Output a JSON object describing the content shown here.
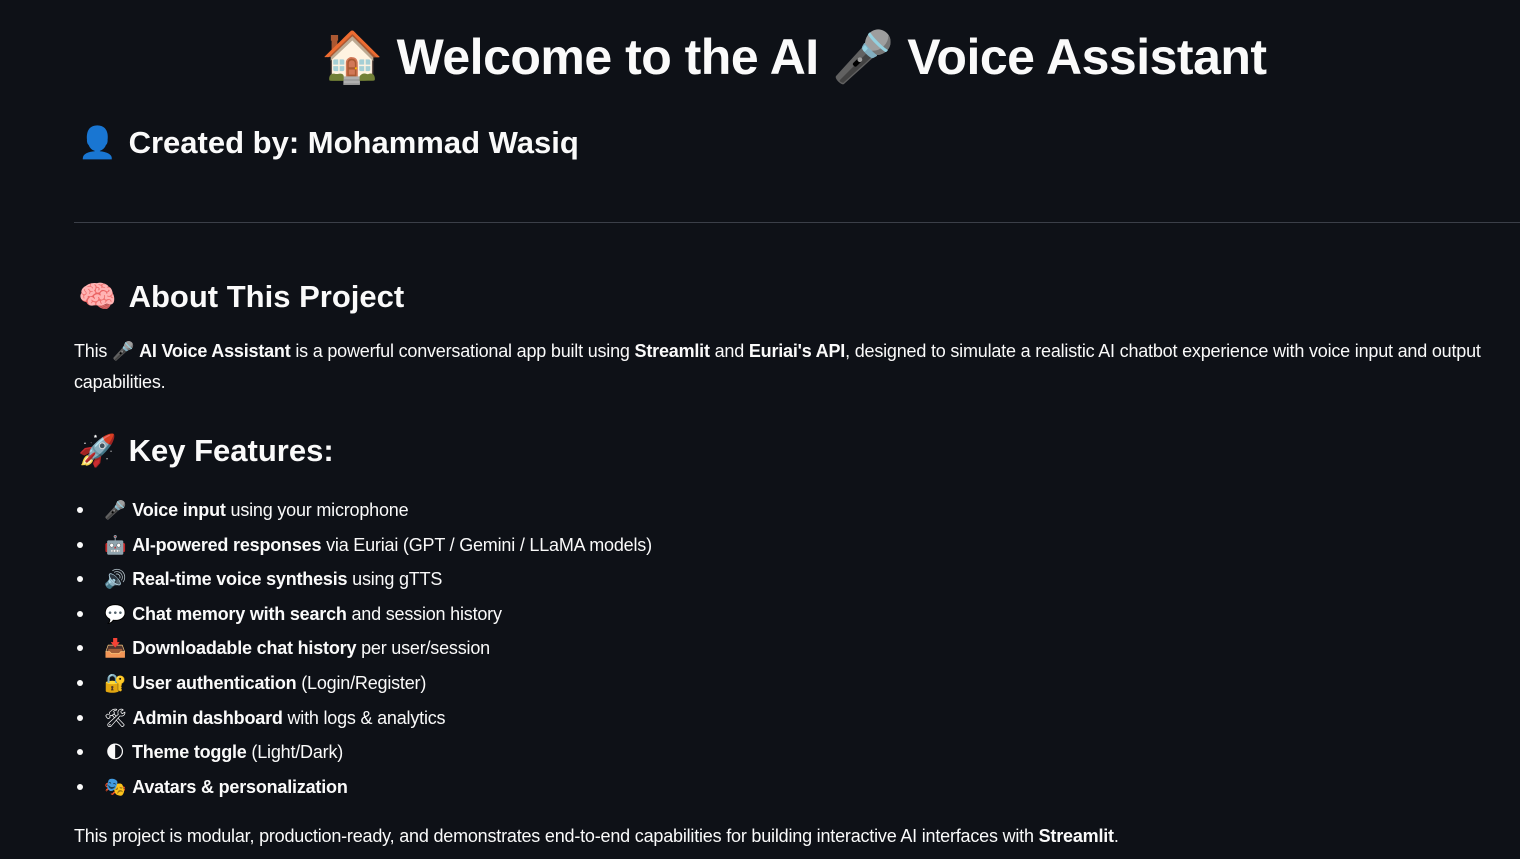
{
  "header": {
    "title_icon_1": "🏠",
    "title_part_1": "Welcome to the AI",
    "title_icon_2": "🎤",
    "title_part_2": "Voice Assistant",
    "author_icon": "👤",
    "author_text": "Created by: Mohammad Wasiq"
  },
  "about": {
    "icon": "🧠",
    "title": "About This Project",
    "text_1": "This",
    "icon_inline": "🎤",
    "bold_1": "AI Voice Assistant",
    "text_2": "is a powerful conversational app built using",
    "bold_2": "Streamlit",
    "text_3": "and",
    "bold_3": "Euriai's API",
    "text_4": ", designed to simulate a realistic AI chatbot experience with voice input and output capabilities."
  },
  "features": {
    "icon": "🚀",
    "title": "Key Features:",
    "items": [
      {
        "icon": "🎤",
        "bold": "Voice input",
        "rest": "using your microphone"
      },
      {
        "icon": "🤖",
        "bold": "AI-powered responses",
        "rest": "via Euriai (GPT / Gemini / LLaMA models)"
      },
      {
        "icon": "🔊",
        "bold": "Real-time voice synthesis",
        "rest": "using gTTS"
      },
      {
        "icon": "💬",
        "bold": "Chat memory with search",
        "rest": "and session history"
      },
      {
        "icon": "📥",
        "bold": "Downloadable chat history",
        "rest": "per user/session"
      },
      {
        "icon": "🔐",
        "bold": "User authentication",
        "rest": "(Login/Register)"
      },
      {
        "icon": "🛠",
        "bold": "Admin dashboard",
        "rest": "with logs & analytics"
      },
      {
        "icon": "🌓",
        "bold": "Theme toggle",
        "rest": "(Light/Dark)"
      },
      {
        "icon": "🎭",
        "bold": "Avatars & personalization",
        "rest": ""
      }
    ]
  },
  "footer": {
    "text": "This project is modular, production-ready, and demonstrates end-to-end capabilities for building interactive AI interfaces with",
    "bold": "Streamlit",
    "end": "."
  }
}
